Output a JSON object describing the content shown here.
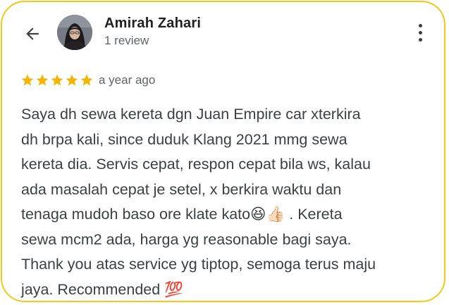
{
  "reviewer": {
    "name": "Amirah Zahari",
    "review_count": "1 review"
  },
  "rating": {
    "stars": 5,
    "max": 5,
    "star_color": "#f4b400"
  },
  "time_ago": "a year ago",
  "review_text": "Saya dh sewa kereta dgn Juan Empire car xterkira\ndh brpa kali, since duduk Klang 2021 mmg sewa\nkereta dia. Servis cepat, respon cepat bila ws, kalau\nada masalah cepat je setel, x berkira waktu dan\ntenaga mudoh baso ore klate kato😆👍🏻 . Kereta\nsewa mcm2 ada, harga yg reasonable bagi saya.\nThank you atas service yg tiptop, semoga terus maju\njaya. Recommended 💯",
  "icons": {
    "back": "arrow-back-icon",
    "more": "more-vert-icon",
    "star": "star-icon"
  },
  "colors": {
    "border": "#f2c81c",
    "text": "#3c4043",
    "secondary": "#5f6368"
  }
}
